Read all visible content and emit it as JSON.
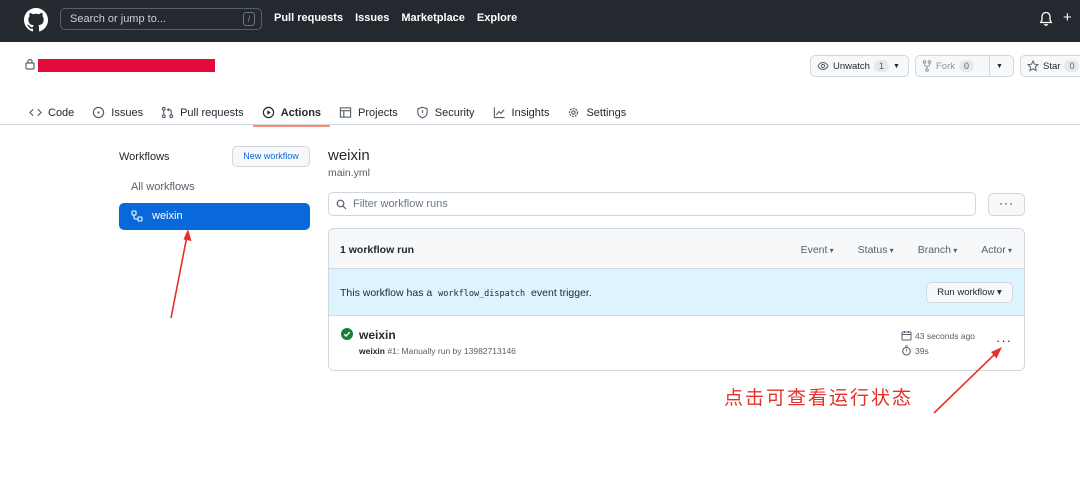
{
  "header": {
    "search_placeholder": "Search or jump to...",
    "search_key": "/",
    "nav": [
      "Pull requests",
      "Issues",
      "Marketplace",
      "Explore"
    ],
    "plus": "+"
  },
  "repo": {
    "watch_label": "Unwatch",
    "watch_count": "1",
    "fork_label": "Fork",
    "fork_count": "0",
    "star_label": "Star",
    "star_count": "0",
    "tabs": [
      "Code",
      "Issues",
      "Pull requests",
      "Actions",
      "Projects",
      "Security",
      "Insights",
      "Settings"
    ],
    "active_tab": "Actions"
  },
  "sidebar": {
    "title": "Workflows",
    "new_workflow": "New workflow",
    "all_workflows": "All workflows",
    "selected": "weixin"
  },
  "main": {
    "title": "weixin",
    "file": "main.yml",
    "filter_placeholder": "Filter workflow runs",
    "more": "···",
    "runs_count": "1 workflow run",
    "filters": [
      "Event",
      "Status",
      "Branch",
      "Actor"
    ],
    "dispatch_prefix": "This workflow has a",
    "dispatch_code": "workflow_dispatch",
    "dispatch_suffix": "event trigger.",
    "run_workflow": "Run workflow ▾",
    "run": {
      "name": "weixin",
      "meta_bold": "weixin",
      "meta_rest": "#1: Manually run by 13982713146",
      "time": "43 seconds ago",
      "duration": "39s",
      "more": "···"
    }
  },
  "annotation": "点击可查看运行状态",
  "colors": {
    "accent": "#0969da",
    "success": "#1a7f37",
    "annotation": "#e5312b",
    "redacted": "#e30b3c"
  }
}
